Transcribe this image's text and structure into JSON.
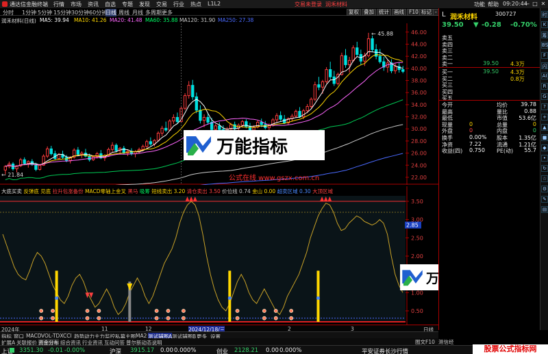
{
  "window": {
    "app_title": "通达信金融终端",
    "menu": [
      "行情",
      "市场",
      "资讯",
      "自选",
      "专题",
      "发现",
      "交易",
      "行业",
      "热点",
      "L1L2"
    ],
    "broker_links": [
      "交易未登录",
      "润禾材料"
    ],
    "right_menu": [
      "功能",
      "帮助"
    ],
    "clock": "09:20:44",
    "controls": [
      "—",
      "□",
      "✕"
    ]
  },
  "period_bar": {
    "items": [
      "分时",
      "1分钟",
      "5分钟",
      "15分钟",
      "30分钟",
      "60分钟",
      "日线",
      "周线",
      "月线",
      "多周期",
      "更多"
    ],
    "selected": "日线",
    "tools": [
      "复权",
      "叠加",
      "统计",
      "画线",
      "F10",
      "标记",
      "-"
    ]
  },
  "main_chart": {
    "header": {
      "stock": "润禾材料(日线)",
      "ma": [
        {
          "label": "MA5: 39.94",
          "color": "#ffffff"
        },
        {
          "label": "MA10: 41.26",
          "color": "#ffd700"
        },
        {
          "label": "MA20: 41.48",
          "color": "#ff66ff"
        },
        {
          "label": "MA60: 35.88",
          "color": "#00ff66"
        },
        {
          "label": "MA120: 31.90",
          "color": "#cccccc"
        },
        {
          "label": "MA250: 27.38",
          "color": "#4a6aff"
        }
      ]
    },
    "price_high_label": "45.88",
    "price_low_label": "21.84",
    "y_ticks": [
      "46.00",
      "44.00",
      "42.00",
      "40.00",
      "38.00",
      "36.00",
      "34.00",
      "32.00",
      "30.00",
      "28.00",
      "26.00",
      "24.00",
      "22.00"
    ],
    "candles": [
      [
        23.2,
        24.0,
        22.5,
        23.8
      ],
      [
        23.8,
        24.6,
        23.5,
        24.2
      ],
      [
        24.2,
        24.5,
        23.1,
        23.4
      ],
      [
        23.4,
        24.0,
        22.8,
        23.9
      ],
      [
        23.9,
        25.2,
        23.7,
        24.9
      ],
      [
        24.9,
        25.3,
        24.0,
        24.3
      ],
      [
        24.3,
        24.8,
        23.6,
        24.6
      ],
      [
        24.6,
        25.0,
        23.9,
        24.1
      ],
      [
        24.1,
        24.4,
        23.0,
        23.3
      ],
      [
        23.3,
        24.2,
        23.1,
        24.0
      ],
      [
        24.0,
        25.8,
        23.9,
        25.5
      ],
      [
        25.5,
        27.1,
        25.2,
        26.7
      ],
      [
        26.7,
        27.2,
        25.6,
        25.9
      ],
      [
        25.9,
        26.4,
        24.8,
        25.1
      ],
      [
        25.1,
        26.0,
        24.9,
        25.8
      ],
      [
        25.8,
        26.4,
        25.0,
        25.3
      ],
      [
        25.3,
        25.7,
        24.5,
        24.8
      ],
      [
        24.8,
        25.5,
        24.3,
        25.3
      ],
      [
        25.3,
        26.8,
        25.1,
        26.5
      ],
      [
        26.5,
        27.0,
        25.6,
        25.8
      ],
      [
        25.8,
        26.3,
        25.2,
        26.0
      ],
      [
        26.0,
        26.7,
        25.3,
        25.5
      ],
      [
        25.5,
        25.9,
        24.6,
        24.9
      ],
      [
        24.9,
        25.6,
        24.7,
        25.4
      ],
      [
        25.4,
        26.2,
        25.1,
        25.9
      ],
      [
        25.9,
        26.5,
        25.0,
        25.2
      ],
      [
        25.2,
        25.8,
        24.7,
        25.6
      ],
      [
        25.6,
        26.9,
        25.4,
        26.6
      ],
      [
        26.6,
        27.8,
        26.2,
        27.3
      ],
      [
        27.3,
        27.6,
        26.1,
        26.4
      ],
      [
        26.4,
        27.0,
        25.9,
        26.8
      ],
      [
        26.8,
        27.2,
        25.8,
        26.0
      ],
      [
        26.0,
        26.6,
        25.5,
        26.3
      ],
      [
        26.3,
        26.8,
        25.6,
        25.9
      ],
      [
        25.9,
        26.5,
        25.3,
        26.2
      ],
      [
        26.2,
        26.9,
        25.9,
        26.6
      ],
      [
        26.6,
        27.4,
        26.3,
        27.1
      ],
      [
        27.1,
        28.2,
        26.9,
        27.9
      ],
      [
        27.9,
        28.6,
        27.2,
        27.5
      ],
      [
        27.5,
        28.3,
        27.1,
        28.1
      ],
      [
        28.1,
        29.6,
        27.9,
        29.3
      ],
      [
        29.3,
        30.5,
        28.8,
        30.1
      ],
      [
        30.1,
        31.2,
        29.5,
        29.8
      ],
      [
        29.8,
        31.6,
        29.7,
        31.3
      ],
      [
        31.3,
        32.4,
        30.8,
        31.9
      ],
      [
        31.9,
        32.7,
        30.9,
        31.2
      ],
      [
        31.2,
        33.8,
        31.0,
        33.4
      ],
      [
        33.4,
        35.9,
        33.1,
        35.5
      ],
      [
        35.5,
        37.9,
        35.0,
        37.2
      ],
      [
        37.2,
        38.1,
        34.8,
        35.3
      ],
      [
        35.3,
        36.0,
        32.6,
        33.1
      ],
      [
        33.1,
        33.9,
        30.9,
        31.4
      ],
      [
        31.4,
        32.4,
        30.3,
        31.9
      ],
      [
        31.9,
        32.6,
        30.7,
        31.1
      ],
      [
        31.1,
        31.8,
        29.4,
        29.9
      ],
      [
        29.9,
        30.8,
        29.2,
        30.5
      ],
      [
        30.5,
        31.1,
        29.6,
        29.9
      ],
      [
        29.9,
        30.6,
        29.0,
        29.3
      ],
      [
        29.3,
        30.3,
        28.9,
        30.0
      ],
      [
        30.0,
        31.0,
        29.7,
        30.7
      ],
      [
        30.7,
        31.2,
        29.8,
        30.1
      ],
      [
        30.1,
        30.9,
        29.6,
        30.6
      ],
      [
        30.6,
        31.5,
        30.2,
        31.2
      ],
      [
        31.2,
        31.6,
        30.1,
        30.4
      ],
      [
        30.4,
        31.0,
        29.5,
        29.8
      ],
      [
        29.8,
        30.6,
        29.4,
        30.3
      ],
      [
        30.3,
        31.4,
        30.1,
        31.1
      ],
      [
        31.1,
        31.7,
        30.3,
        30.7
      ],
      [
        30.7,
        31.3,
        29.9,
        30.2
      ],
      [
        30.2,
        30.9,
        29.6,
        30.6
      ],
      [
        30.6,
        31.8,
        30.4,
        31.5
      ],
      [
        31.5,
        32.6,
        31.1,
        32.2
      ],
      [
        32.2,
        32.9,
        31.3,
        31.6
      ],
      [
        31.6,
        32.3,
        30.8,
        31.0
      ],
      [
        31.0,
        31.9,
        30.6,
        31.7
      ],
      [
        31.7,
        32.5,
        31.2,
        32.1
      ],
      [
        32.1,
        33.2,
        31.9,
        32.9
      ],
      [
        32.9,
        33.6,
        31.8,
        32.0
      ],
      [
        32.0,
        33.3,
        31.6,
        33.0
      ],
      [
        33.0,
        34.1,
        32.6,
        33.7
      ],
      [
        33.7,
        35.2,
        33.4,
        34.9
      ],
      [
        34.9,
        37.8,
        34.6,
        37.3
      ],
      [
        37.3,
        38.6,
        36.4,
        36.9
      ],
      [
        36.9,
        38.1,
        35.8,
        37.8
      ],
      [
        37.8,
        40.2,
        37.5,
        39.8
      ],
      [
        39.8,
        41.1,
        38.2,
        38.6
      ],
      [
        38.6,
        39.6,
        37.1,
        37.5
      ],
      [
        37.5,
        39.3,
        37.2,
        39.0
      ],
      [
        39.0,
        42.6,
        38.8,
        42.1
      ],
      [
        42.1,
        43.2,
        40.1,
        40.6
      ],
      [
        40.6,
        41.9,
        39.3,
        41.3
      ],
      [
        41.3,
        43.8,
        41.0,
        43.4
      ],
      [
        43.4,
        44.4,
        41.9,
        42.3
      ],
      [
        42.3,
        43.1,
        40.6,
        41.2
      ],
      [
        41.2,
        42.6,
        40.4,
        42.1
      ],
      [
        42.1,
        45.88,
        41.8,
        44.9
      ],
      [
        44.9,
        45.4,
        42.7,
        43.1
      ],
      [
        43.1,
        44.0,
        41.5,
        42.0
      ],
      [
        42.0,
        43.2,
        40.8,
        41.1
      ],
      [
        41.1,
        41.9,
        39.6,
        40.2
      ],
      [
        40.2,
        41.4,
        39.3,
        40.9
      ],
      [
        40.9,
        41.5,
        39.2,
        39.6
      ],
      [
        39.6,
        40.8,
        39.1,
        40.3
      ],
      [
        40.3,
        40.9,
        39.3,
        39.8
      ],
      [
        39.8,
        40.4,
        39.2,
        39.5
      ]
    ]
  },
  "indicator": {
    "header": {
      "name": "大底买卖",
      "items": [
        {
          "label": "反弹底",
          "color": "#ffd700"
        },
        {
          "label": "见底",
          "color": "#ffd700"
        },
        {
          "label": "拉升包涨备份",
          "color": "#ff4040"
        },
        {
          "label": "MACD零轴上金叉",
          "color": "#ffd700"
        },
        {
          "label": "黑马",
          "color": "#ff4040"
        },
        {
          "label": "吸筹",
          "color": "#00ff66"
        },
        {
          "label": "短线卖出 3.20",
          "color": "#ffd700"
        },
        {
          "label": "清仓卖出 3.50",
          "color": "#ff4040"
        },
        {
          "label": "价位线 0.74",
          "color": "#cccccc"
        },
        {
          "label": "金山 0.00",
          "color": "#ffd700"
        },
        {
          "label": "超卖区域 0.30",
          "color": "#4a8aff"
        },
        {
          "label": "大顶区域",
          "color": "#ff4040"
        }
      ]
    },
    "y_ticks": [
      "3.50",
      "3.00",
      "2.50",
      "2.00",
      "1.50",
      "1.00",
      "0.50"
    ],
    "current_value_label": "2.85",
    "line": [
      2.6,
      2.3,
      2.0,
      1.7,
      1.5,
      1.4,
      1.35,
      1.6,
      1.9,
      2.1,
      2.0,
      1.8,
      1.5,
      1.2,
      1.0,
      0.8,
      0.7,
      0.9,
      1.2,
      1.4,
      1.5,
      1.3,
      1.0,
      0.8,
      0.6,
      0.7,
      0.9,
      1.1,
      0.9,
      0.6,
      0.4,
      0.5,
      0.7,
      1.0,
      1.2,
      1.4,
      1.2,
      0.9,
      0.7,
      0.9,
      1.2,
      1.5,
      1.8,
      2.0,
      2.2,
      2.5,
      2.9,
      3.2,
      3.4,
      3.5,
      3.4,
      3.1,
      2.6,
      2.0,
      1.5,
      1.1,
      0.8,
      0.6,
      0.5,
      0.7,
      1.0,
      1.3,
      1.5,
      1.3,
      1.0,
      0.8,
      0.7,
      0.9,
      1.1,
      0.9,
      0.7,
      0.5,
      0.4,
      0.6,
      0.9,
      1.1,
      1.3,
      1.5,
      1.8,
      2.1,
      2.5,
      2.8,
      3.1,
      3.3,
      3.45,
      3.4,
      3.2,
      2.9,
      2.7,
      2.75,
      2.9,
      3.0,
      3.1,
      3.05,
      2.95,
      2.9,
      2.85,
      2.9,
      3.0,
      2.9,
      2.6,
      2.0,
      1.5,
      1.2,
      1.0
    ]
  },
  "date_axis": [
    "2024年",
    "11",
    "12",
    "2024/12/18/三",
    "2",
    "3",
    "日线"
  ],
  "indicator_tabs": {
    "items": [
      "指标",
      "窗口",
      "MACD",
      "VOL-TDX",
      "CCI",
      "趋势动力",
      "主力监控",
      "私募主图",
      "MA2",
      "测试辅图A",
      "测试辅图B",
      "更多",
      "设置"
    ],
    "active": "测试辅图A"
  },
  "ext_tabs": {
    "items": [
      "扩展A",
      "关联报价",
      "资金分布",
      "综合资讯",
      "行业资讯",
      "互动问答",
      "普尔新动态说明"
    ],
    "active": "资金分布"
  },
  "watermark": {
    "text": "万能指标",
    "site": "公式在线 www.gszx.com.cn"
  },
  "quote_panel": {
    "name": "润禾材料",
    "code": "300727",
    "price": "39.50",
    "change": "-0.28",
    "change_pct": "-0.70%",
    "asks": [
      {
        "label": "卖五",
        "price": "",
        "vol": ""
      },
      {
        "label": "卖四",
        "price": "",
        "vol": ""
      },
      {
        "label": "卖三",
        "price": "",
        "vol": ""
      },
      {
        "label": "卖二",
        "price": "",
        "vol": ""
      },
      {
        "label": "卖一",
        "price": "39.50",
        "vol": "4.3万"
      }
    ],
    "bids": [
      {
        "label": "买一",
        "price": "39.50",
        "vol": "4.3万"
      },
      {
        "label": "买二",
        "price": "",
        "vol": "0.8万"
      },
      {
        "label": "买三",
        "price": "",
        "vol": ""
      },
      {
        "label": "买四",
        "price": "",
        "vol": ""
      },
      {
        "label": "买五",
        "price": "",
        "vol": ""
      }
    ],
    "stats": [
      {
        "l1": "今开",
        "v1": "",
        "l2": "均价",
        "v2": "39.78",
        "c1": "#ffffff",
        "c2": "#ffffff"
      },
      {
        "l1": "最高",
        "v1": "",
        "l2": "量比",
        "v2": "0.88",
        "c1": "#ff4646",
        "c2": "#ffffff"
      },
      {
        "l1": "最低",
        "v1": "",
        "l2": "市值",
        "v2": "53.6亿",
        "c1": "#35d06a",
        "c2": "#ffffff"
      },
      {
        "l1": "现量",
        "v1": "0",
        "l2": "总量",
        "v2": "0",
        "c1": "#ffd700",
        "c2": "#ffd700"
      },
      {
        "l1": "外盘",
        "v1": "0",
        "l2": "内盘",
        "v2": "0",
        "c1": "#ff4646",
        "c2": "#35d06a"
      },
      {
        "l1": "换手",
        "v1": "0.00%",
        "l2": "股本",
        "v2": "1.35亿",
        "c1": "#ffffff",
        "c2": "#ffffff"
      },
      {
        "l1": "净资",
        "v1": "7.22",
        "l2": "流通",
        "v2": "1.21亿",
        "c1": "#ffffff",
        "c2": "#ffffff"
      },
      {
        "l1": "收益(四)",
        "v1": "0.750",
        "l2": "PE(动)",
        "v2": "55.7",
        "c1": "#ffffff",
        "c2": "#ffffff"
      }
    ]
  },
  "side_tools": [
    "时",
    "K",
    "筹",
    "BS",
    "F",
    "闪",
    "AI",
    "R",
    "G",
    "?",
    "+",
    "▲",
    "■",
    "◆",
    "•",
    "↻",
    "☆",
    "⚙",
    "✎",
    "▤"
  ],
  "bottom_right": [
    "图文F10",
    "测信经",
    "↑"
  ],
  "status": {
    "items": [
      {
        "label": "上证",
        "color": "#e8e8e8"
      },
      {
        "label": "3351.30",
        "color": "#35d06a"
      },
      {
        "label": "-0.01",
        "color": "#35d06a"
      },
      {
        "label": "-0.00%",
        "color": "#35d06a"
      },
      {
        "label": "沪深",
        "color": "#e8e8e8"
      },
      {
        "label": "3915.17",
        "color": "#35d06a"
      },
      {
        "label": "0.00",
        "color": "#e8e8e8"
      },
      {
        "label": "0.000%",
        "color": "#e8e8e8"
      },
      {
        "label": "创业",
        "color": "#e8e8e8"
      },
      {
        "label": "2128.21",
        "color": "#35d06a"
      },
      {
        "label": "0.00",
        "color": "#e8e8e8"
      },
      {
        "label": "0.000%",
        "color": "#e8e8e8"
      },
      {
        "label": "平安证券长沙行情",
        "color": "#e8e8e8"
      }
    ],
    "brand": "股票公式指标网"
  }
}
